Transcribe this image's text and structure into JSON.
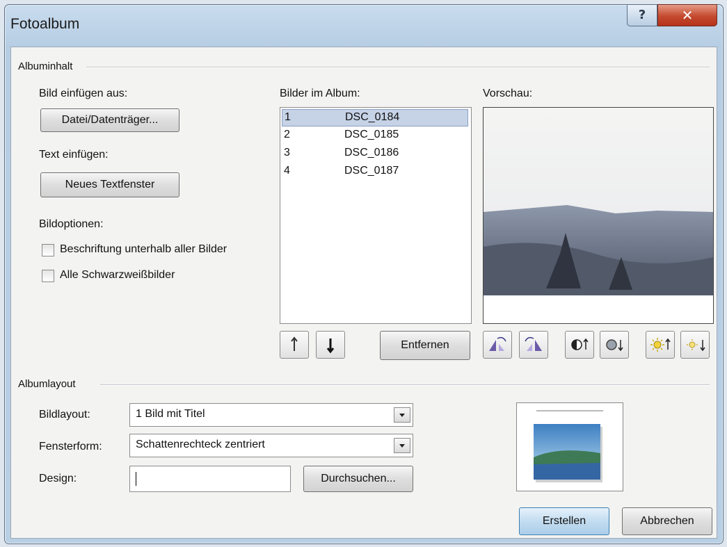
{
  "window": {
    "title": "Fotoalbum",
    "help_glyph": "?",
    "close_glyph": "✕"
  },
  "album_content": {
    "group_label": "Albuminhalt",
    "insert_picture_from": "Bild einfügen aus:",
    "file_button": "Datei/Datenträger...",
    "insert_text": "Text einfügen:",
    "new_textbox_button": "Neues Textfenster",
    "picture_options": "Bildoptionen:",
    "caption_checkbox": {
      "label": "Beschriftung unterhalb aller Bilder",
      "checked": false
    },
    "bw_checkbox": {
      "label": "Alle Schwarzweißbilder",
      "checked": false
    },
    "pictures_label": "Bilder im Album:",
    "pictures": [
      {
        "num": "1",
        "name": "DSC_0184",
        "selected": true
      },
      {
        "num": "2",
        "name": "DSC_0185",
        "selected": false
      },
      {
        "num": "3",
        "name": "DSC_0186",
        "selected": false
      },
      {
        "num": "4",
        "name": "DSC_0187",
        "selected": false
      }
    ],
    "remove_button": "Entfernen",
    "preview_label": "Vorschau:"
  },
  "album_layout": {
    "group_label": "Albumlayout",
    "picture_layout_label": "Bildlayout:",
    "picture_layout_value": "1 Bild mit Titel",
    "frame_shape_label": "Fensterform:",
    "frame_shape_value": "Schattenrechteck zentriert",
    "design_label": "Design:",
    "design_value": "",
    "browse_button": "Durchsuchen..."
  },
  "footer": {
    "create_button": "Erstellen",
    "cancel_button": "Abbrechen"
  }
}
